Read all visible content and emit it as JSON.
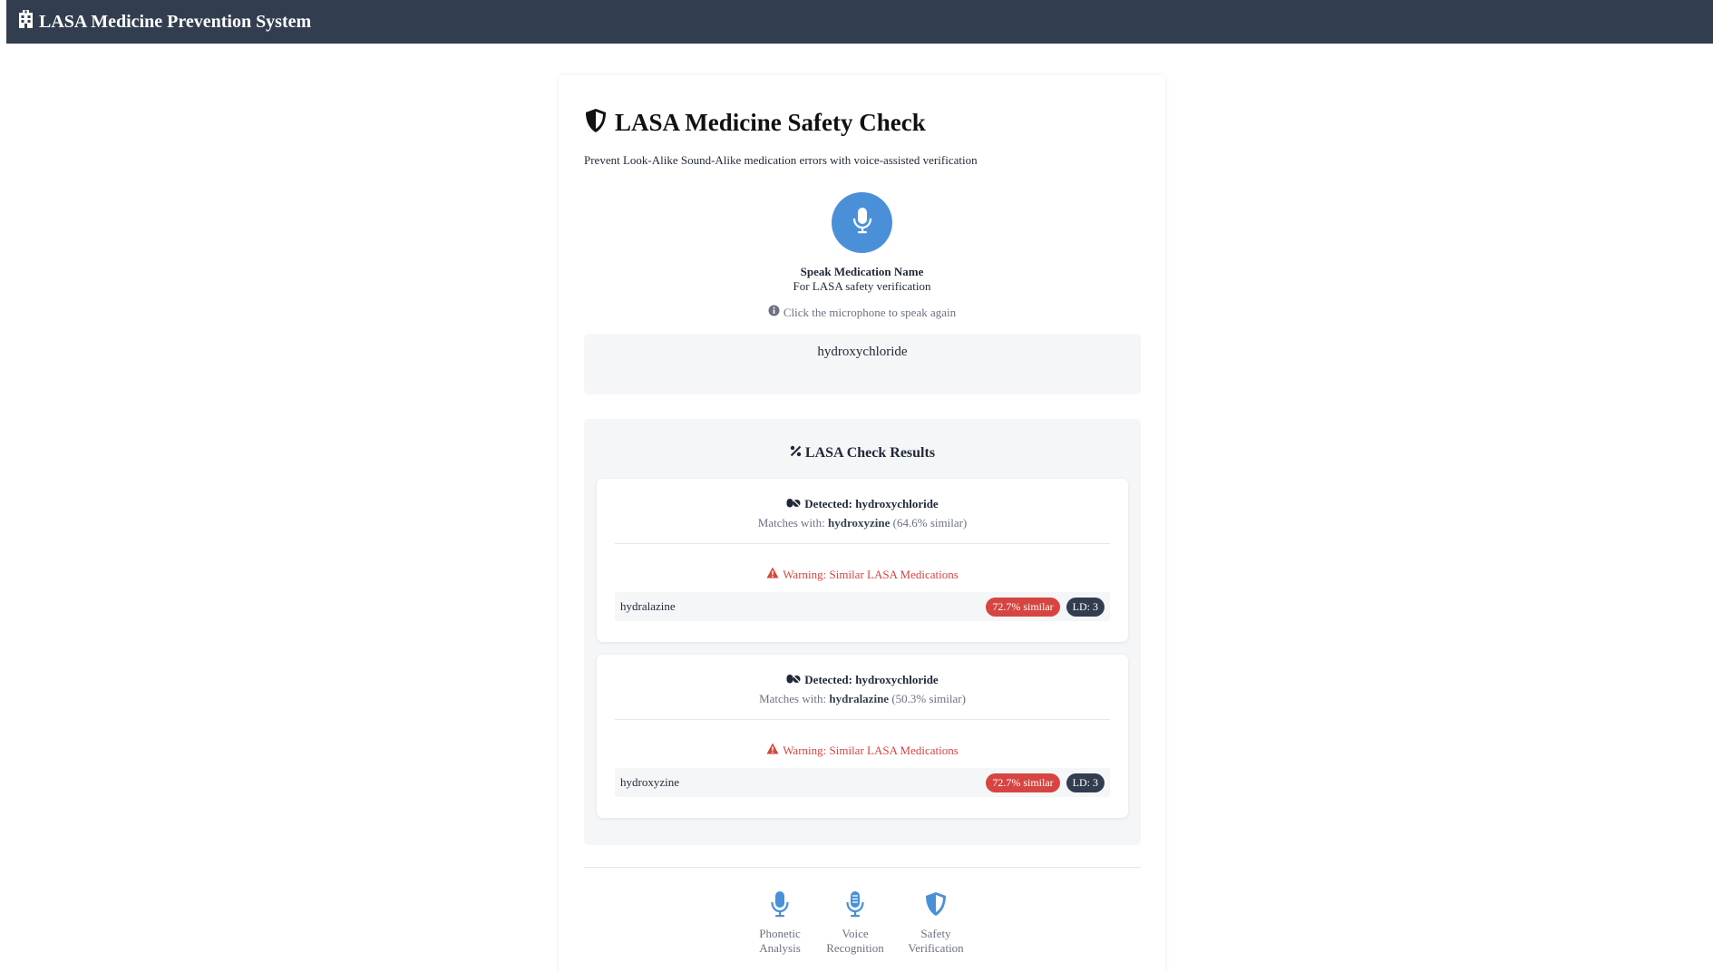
{
  "navbar": {
    "icon": "hospital-icon",
    "title": "LASA Medicine Prevention System"
  },
  "header": {
    "icon": "shield-icon",
    "title": "LASA Medicine Safety Check",
    "subtitle": "Prevent Look-Alike Sound-Alike medication errors with voice-assisted verification"
  },
  "voice": {
    "mic_icon": "microphone-icon",
    "title": "Speak Medication Name",
    "subtitle": "For LASA safety verification",
    "hint_icon": "info-circle-icon",
    "hint": "Click the microphone to speak again",
    "transcript": "hydroxychloride"
  },
  "results": {
    "icon": "percent-icon",
    "title": "LASA Check Results",
    "items": [
      {
        "detected_icon": "pills-icon",
        "detected": "Detected: hydroxychloride",
        "matches_prefix": "Matches with:",
        "match_name": "hydroxyzine",
        "match_similarity": "(64.6% similar)",
        "warning_icon": "warning-triangle-icon",
        "warning": "Warning: Similar LASA Medications",
        "similar": [
          {
            "name": "hydralazine",
            "similarity": "72.7% similar",
            "ld": "LD: 3"
          }
        ]
      },
      {
        "detected_icon": "pills-icon",
        "detected": "Detected: hydroxychloride",
        "matches_prefix": "Matches with:",
        "match_name": "hydralazine",
        "match_similarity": "(50.3% similar)",
        "warning_icon": "warning-triangle-icon",
        "warning": "Warning: Similar LASA Medications",
        "similar": [
          {
            "name": "hydroxyzine",
            "similarity": "72.7% similar",
            "ld": "LD: 3"
          }
        ]
      }
    ]
  },
  "features": [
    {
      "icon": "microphone-icon",
      "line1": "Phonetic",
      "line2": "Analysis"
    },
    {
      "icon": "microphone-lines-icon",
      "line1": "Voice",
      "line2": "Recognition"
    },
    {
      "icon": "shield-icon",
      "line1": "Safety",
      "line2": "Verification"
    }
  ],
  "colors": {
    "navbar": "#323e4f",
    "accent": "#4a90d9",
    "warning": "#d64541",
    "badge_dark": "#323e4f",
    "panel": "#f5f6f8"
  }
}
